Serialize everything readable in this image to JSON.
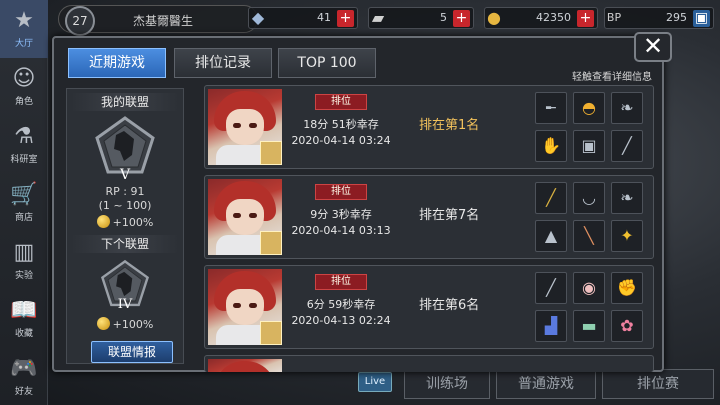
{
  "sidebar": {
    "items": [
      {
        "label": "大厅",
        "icon": "star-logo-icon",
        "active": true
      },
      {
        "label": "角色",
        "icon": "character-icon"
      },
      {
        "label": "科研室",
        "icon": "flask-icon"
      },
      {
        "label": "商店",
        "icon": "cart-icon"
      },
      {
        "label": "实验",
        "icon": "books-icon"
      },
      {
        "label": "收藏",
        "icon": "book-open-icon"
      },
      {
        "label": "好友",
        "icon": "gamepad-icon"
      }
    ]
  },
  "topbar": {
    "level": "27",
    "player_name": "杰基爾醫生",
    "resources": [
      {
        "icon": "gem-icon",
        "value": "41"
      },
      {
        "icon": "ticket-icon",
        "value": "5"
      },
      {
        "icon": "coin-icon",
        "value": "42350"
      },
      {
        "icon": "bp-icon",
        "value": "295"
      }
    ]
  },
  "background_buttons": {
    "live": "Live",
    "training": "训练场",
    "normal": "普通游戏",
    "ranked": "排位赛"
  },
  "modal": {
    "tabs": [
      {
        "label": "近期游戏",
        "active": true
      },
      {
        "label": "排位记录",
        "active": false
      },
      {
        "label": "TOP 100",
        "active": false
      }
    ],
    "hint": "轻触查看详细信息",
    "alliance": {
      "my_title": "我的联盟",
      "tier": "V",
      "rp": "RP : 91",
      "range": "(1 ~ 100)",
      "bonus": "+100%",
      "next_title": "下个联盟",
      "next_tier": "IV",
      "next_bonus": "+100%",
      "info_button": "联盟情报"
    },
    "matches": [
      {
        "tag": "排位",
        "survival": "18分 51秒幸存",
        "date": "2020-04-14 03:24",
        "placement": "排在第1名",
        "items": [
          "sniper-rifle-icon",
          "helmet-icon",
          "feather-icon",
          "glove-icon",
          "armor-icon",
          "blade-icon"
        ]
      },
      {
        "tag": "排位",
        "survival": "9分 3秒幸存",
        "date": "2020-04-14 03:13",
        "placement": "排在第7名",
        "items": [
          "staff-icon",
          "necklace-icon",
          "feather-icon",
          "chestplate-icon",
          "leg-icon",
          "trinket-icon"
        ]
      },
      {
        "tag": "排位",
        "survival": "6分 59秒幸存",
        "date": "2020-04-13 02:24",
        "placement": "排在第6名",
        "items": [
          "spear-icon",
          "mask-icon",
          "gauntlet-icon",
          "boots-icon",
          "shoes-icon",
          "charm-icon"
        ]
      }
    ]
  }
}
